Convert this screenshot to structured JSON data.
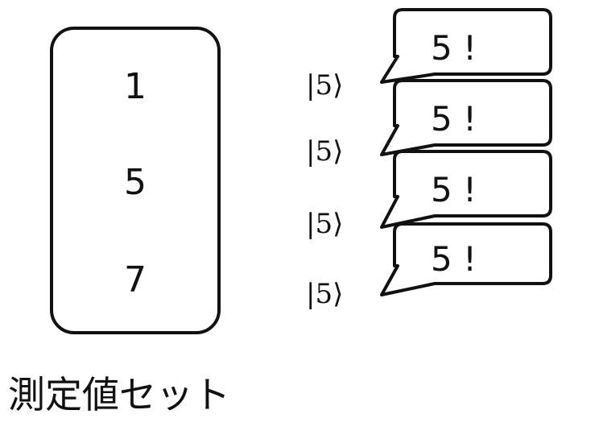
{
  "measurement_set": {
    "values": [
      "1",
      "5",
      "7"
    ],
    "caption": "測定値セット"
  },
  "kets": [
    {
      "label": "|5⟩",
      "bubble": "5 !"
    },
    {
      "label": "|5⟩",
      "bubble": "5 !"
    },
    {
      "label": "|5⟩",
      "bubble": "5 !"
    },
    {
      "label": "|5⟩",
      "bubble": "5 !"
    }
  ]
}
